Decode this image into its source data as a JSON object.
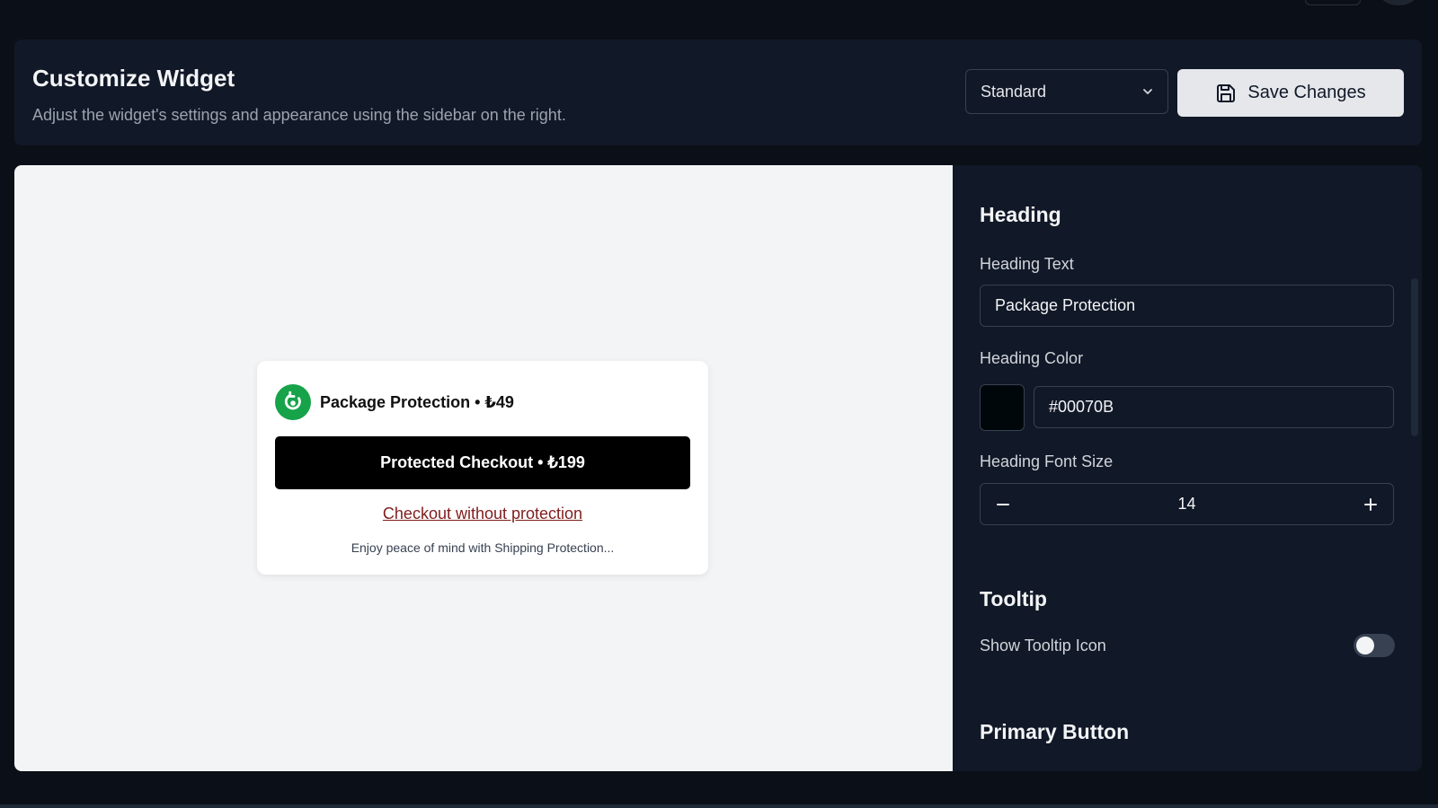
{
  "header": {
    "title": "Customize Widget",
    "subtitle": "Adjust the widget's settings and appearance using the sidebar on the right.",
    "template_select": {
      "value": "Standard"
    },
    "save_label": "Save Changes"
  },
  "preview": {
    "heading": "Package Protection • ₺49",
    "primary_button": "Protected Checkout • ₺199",
    "secondary_link": "Checkout without protection",
    "description": "Enjoy peace of mind with Shipping Protection..."
  },
  "sidebar": {
    "heading_section": {
      "title": "Heading",
      "text_label": "Heading Text",
      "text_value": "Package Protection",
      "color_label": "Heading Color",
      "color_value": "#00070B",
      "font_size_label": "Heading Font Size",
      "font_size_value": "14"
    },
    "tooltip_section": {
      "title": "Tooltip",
      "show_icon_label": "Show Tooltip Icon",
      "show_icon_enabled": false
    },
    "primary_button_section": {
      "title": "Primary Button"
    }
  },
  "colors": {
    "page_bg": "#0b0f17",
    "panel_bg": "#111827",
    "preview_bg": "#f3f4f6",
    "brand_green": "#16a34a",
    "link_color": "#7f1d1d",
    "heading_color": "#00070B"
  },
  "icons": {
    "select_chevron": "chevron-down-icon",
    "save": "save-icon",
    "brand": "refresh-shield-icon",
    "minus": "minus-icon",
    "plus": "plus-icon"
  }
}
